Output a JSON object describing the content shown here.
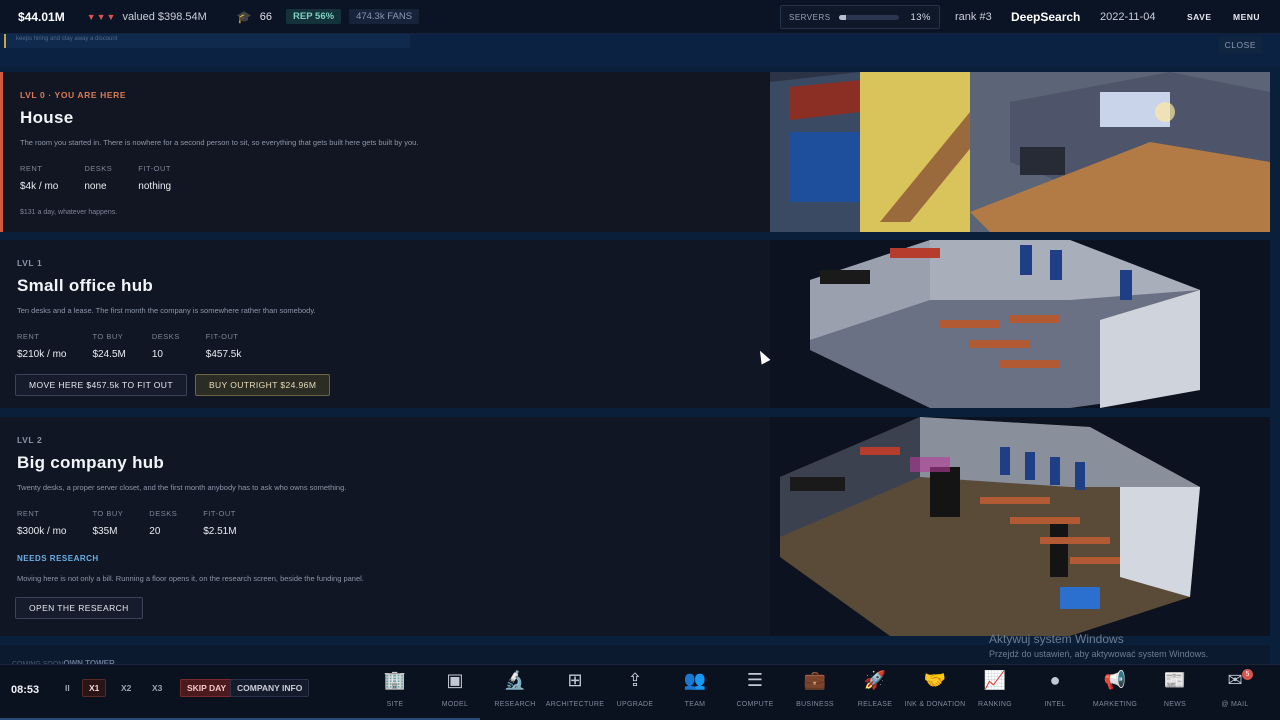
{
  "topbar": {
    "cash": "$44.01M",
    "trend": "▼▼▼",
    "valued": "valued $398.54M",
    "graduates": "66",
    "rep": "REP 56%",
    "fans": "474.3k FANS",
    "servers_label": "SERVERS",
    "servers_pct": "13%",
    "servers_fill": 0.13,
    "rank": "rank #3",
    "company": "DeepSearch",
    "date": "2022-11-04",
    "save_label": "SAVE",
    "menu_label": "MENU"
  },
  "notice": {
    "text": "keeps hiring and stay away a discount",
    "close_label": "CLOSE"
  },
  "levels": [
    {
      "lvl": "LVL 0 · YOU ARE HERE",
      "title": "House",
      "desc": "The room you started in. There is nowhere for a second person to sit, so everything that gets built here gets built by you.",
      "stats": [
        {
          "k": "RENT",
          "v": "$4k / mo"
        },
        {
          "k": "DESKS",
          "v": "none"
        },
        {
          "k": "FIT-OUT",
          "v": "nothing"
        }
      ],
      "foot": "$131 a day, whatever happens."
    },
    {
      "lvl": "LVL 1",
      "title": "Small office hub",
      "desc": "Ten desks and a lease. The first month the company is somewhere rather than somebody.",
      "stats": [
        {
          "k": "RENT",
          "v": "$210k / mo"
        },
        {
          "k": "TO BUY",
          "v": "$24.5M"
        },
        {
          "k": "DESKS",
          "v": "10"
        },
        {
          "k": "FIT-OUT",
          "v": "$457.5k"
        }
      ],
      "move_label": "MOVE HERE $457.5k TO FIT OUT",
      "buy_label": "BUY OUTRIGHT $24.96M"
    },
    {
      "lvl": "LVL 2",
      "title": "Big company hub",
      "desc": "Twenty desks, a proper server closet, and the first month anybody has to ask who owns something.",
      "stats": [
        {
          "k": "RENT",
          "v": "$300k / mo"
        },
        {
          "k": "TO BUY",
          "v": "$35M"
        },
        {
          "k": "DESKS",
          "v": "20"
        },
        {
          "k": "FIT-OUT",
          "v": "$2.51M"
        }
      ],
      "needs": "NEEDS RESEARCH",
      "needs_desc": "Moving here is not only a bill. Running a floor opens it, on the research screen, beside the funding panel.",
      "research_label": "OPEN THE RESEARCH"
    }
  ],
  "coming": {
    "prefix": "COMING SOON",
    "title": "OWN TOWER"
  },
  "watermark": {
    "title": "Aktywuj system Windows",
    "sub": "Przejdź do ustawień, aby aktywować system Windows."
  },
  "bottombar": {
    "clock": "08:53",
    "pause": "II",
    "x1": "X1",
    "x2": "X2",
    "x3": "X3",
    "skip": "SKIP DAY",
    "info": "COMPANY INFO",
    "nav": [
      {
        "label": "SITE",
        "icon": "building-icon"
      },
      {
        "label": "MODEL",
        "icon": "chip-icon"
      },
      {
        "label": "RESEARCH",
        "icon": "microscope-icon"
      },
      {
        "label": "ARCHITECTURE",
        "icon": "hierarchy-icon"
      },
      {
        "label": "UPGRADE",
        "icon": "upgrade-icon"
      },
      {
        "label": "TEAM",
        "icon": "team-icon"
      },
      {
        "label": "COMPUTE",
        "icon": "server-icon"
      },
      {
        "label": "BUSINESS",
        "icon": "briefcase-icon"
      },
      {
        "label": "RELEASE",
        "icon": "rocket-icon"
      },
      {
        "label": "INK & DONATION",
        "icon": "handshake-icon"
      },
      {
        "label": "RANKING",
        "icon": "chart-icon"
      },
      {
        "label": "INTEL",
        "icon": "globe-icon"
      },
      {
        "label": "MARKETING",
        "icon": "megaphone-icon"
      },
      {
        "label": "NEWS",
        "icon": "newspaper-icon"
      },
      {
        "label": "@ MAIL",
        "icon": "mail-icon",
        "badge": "5"
      }
    ]
  },
  "colors": {
    "accent_red": "#d25a3f",
    "research_blue": "#6ab0e8",
    "bg": "#0a1f3a"
  }
}
